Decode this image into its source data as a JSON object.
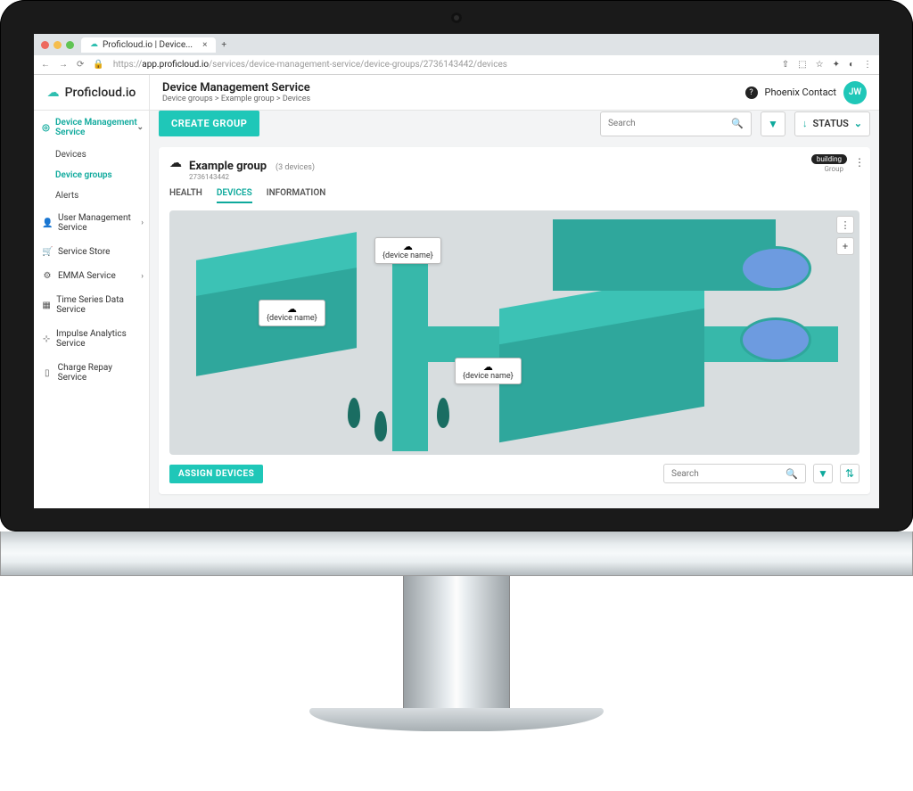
{
  "browser": {
    "tab_title": "Proficloud.io | Device...",
    "url_prefix": "https://",
    "url_host": "app.proficloud.io",
    "url_path": "/services/device-management-service/device-groups/2736143442/devices"
  },
  "brand": "Proficloud.io",
  "header": {
    "title": "Device Management Service",
    "breadcrumb": "Device groups > Example group > Devices",
    "user_name": "Phoenix Contact",
    "avatar_initials": "JW"
  },
  "sidebar": {
    "sections": [
      {
        "label": "Device Management Service",
        "icon": "◎",
        "active": true,
        "expandable": true,
        "children": [
          {
            "label": "Devices"
          },
          {
            "label": "Device groups",
            "active": true
          },
          {
            "label": "Alerts"
          }
        ]
      },
      {
        "label": "User Management Service",
        "icon": "👤",
        "expandable": true
      },
      {
        "label": "Service Store",
        "icon": "🛒"
      },
      {
        "label": "EMMA Service",
        "icon": "⚙",
        "expandable": true
      },
      {
        "label": "Time Series Data Service",
        "icon": "▦"
      },
      {
        "label": "Impulse Analytics Service",
        "icon": "⊹"
      },
      {
        "label": "Charge Repay Service",
        "icon": "▯"
      }
    ]
  },
  "toolbar": {
    "create_group_label": "CREATE GROUP",
    "search_placeholder": "Search",
    "status_label": "STATUS"
  },
  "group": {
    "name": "Example group",
    "count": "(3 devices)",
    "id": "2736143442",
    "tag": "building",
    "type": "Group",
    "tabs": {
      "health": "HEALTH",
      "devices": "DEVICES",
      "info": "INFORMATION"
    },
    "device_labels": [
      "{device name}",
      "{device name}",
      "{device name}"
    ]
  },
  "bottom": {
    "assign_label": "ASSIGN DEVICES",
    "search_placeholder": "Search"
  }
}
